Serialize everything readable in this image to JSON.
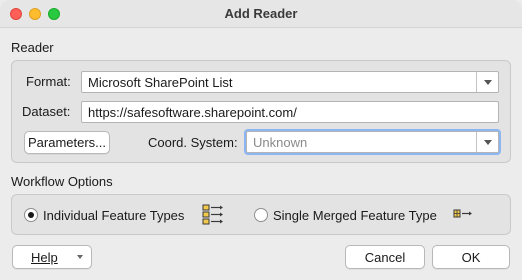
{
  "window": {
    "title": "Add Reader"
  },
  "reader": {
    "section_label": "Reader",
    "format_label": "Format:",
    "format_value": "Microsoft SharePoint List",
    "dataset_label": "Dataset:",
    "dataset_value": "https://safesoftware.sharepoint.com/",
    "parameters_button": "Parameters...",
    "coord_label": "Coord. System:",
    "coord_placeholder": "Unknown"
  },
  "workflow": {
    "section_label": "Workflow Options",
    "option_individual": "Individual Feature Types",
    "option_merged": "Single Merged Feature Type",
    "selected": "individual"
  },
  "footer": {
    "help_button": "Help",
    "cancel_button": "Cancel",
    "ok_button": "OK"
  },
  "colors": {
    "icon_color": "#3a3a3a",
    "icon_fill": "#f2c94c"
  }
}
